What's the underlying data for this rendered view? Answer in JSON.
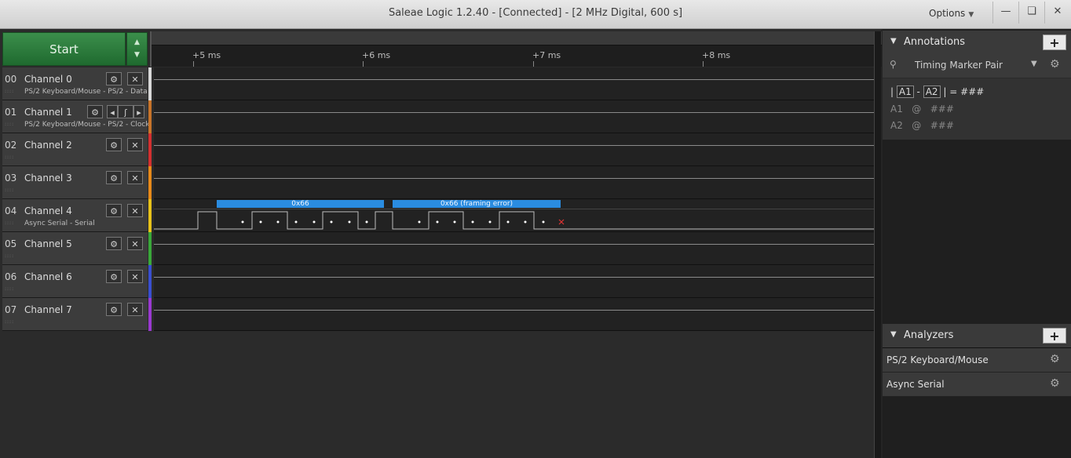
{
  "window": {
    "title": "Saleae Logic 1.2.40 - [Connected] - [2 MHz Digital, 600 s]",
    "options_label": "Options"
  },
  "start": {
    "label": "Start"
  },
  "timeline": {
    "ticks": [
      "+5 ms",
      "+6 ms",
      "+7 ms",
      "+8 ms"
    ]
  },
  "channels": [
    {
      "num": "00",
      "name": "Channel 0",
      "sub": "PS/2 Keyboard/Mouse - PS/2 - Data",
      "color": "#d9d9d9"
    },
    {
      "num": "01",
      "name": "Channel 1",
      "sub": "PS/2 Keyboard/Mouse - PS/2 - Clock",
      "color": "#c8742a"
    },
    {
      "num": "02",
      "name": "Channel 2",
      "sub": "",
      "color": "#d33030"
    },
    {
      "num": "03",
      "name": "Channel 3",
      "sub": "",
      "color": "#e88a1a"
    },
    {
      "num": "04",
      "name": "Channel 4",
      "sub": "Async Serial - Serial",
      "color": "#e8c21a"
    },
    {
      "num": "05",
      "name": "Channel 5",
      "sub": "",
      "color": "#3aa83a"
    },
    {
      "num": "06",
      "name": "Channel 6",
      "sub": "",
      "color": "#3a4fd0"
    },
    {
      "num": "07",
      "name": "Channel 7",
      "sub": "",
      "color": "#9a3ad0"
    }
  ],
  "serial_frames": [
    {
      "label": "0x66"
    },
    {
      "label": "0x66 (framing error)"
    }
  ],
  "annotations": {
    "header": "Annotations",
    "marker_pair": "Timing Marker Pair",
    "a1": "A1",
    "a2": "A2",
    "dash": "-",
    "pipe": "|",
    "eq": "| =",
    "hash": "###",
    "at": "@"
  },
  "analyzers": {
    "header": "Analyzers",
    "items": [
      "PS/2 Keyboard/Mouse",
      "Async Serial"
    ]
  }
}
